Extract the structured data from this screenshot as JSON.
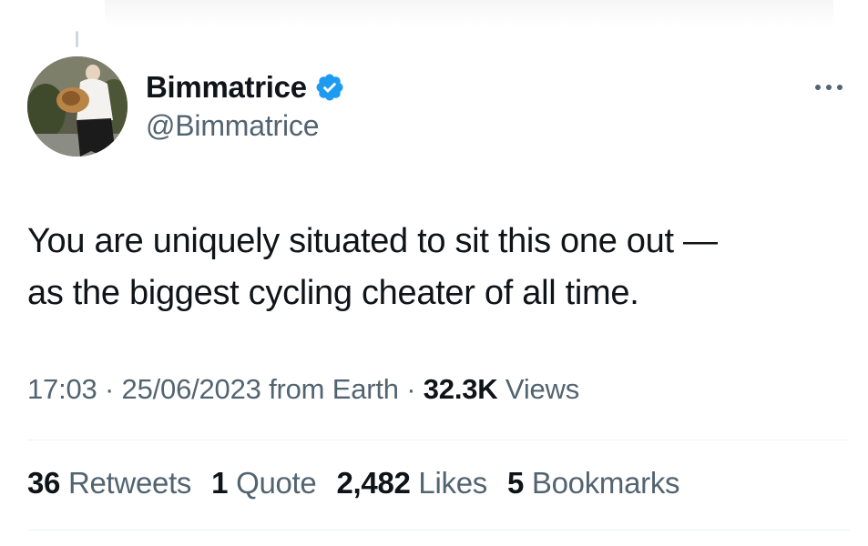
{
  "tweet": {
    "author": {
      "display_name": "Bimmatrice",
      "handle": "@Bimmatrice",
      "verified_icon": "verified-badge-icon",
      "verified_color": "#1d9bf0"
    },
    "text": "You are uniquely situated to sit this one out —\nas the biggest cycling cheater of all time.",
    "meta": {
      "time": "17:03",
      "sep1": " · ",
      "date": "25/06/2023",
      "source": " from Earth",
      "sep2": " · ",
      "views_count": "32.3K",
      "views_label": " Views"
    },
    "stats": {
      "retweets_count": "36",
      "retweets_label": " Retweets",
      "quotes_count": "1",
      "quotes_label": " Quote",
      "likes_count": "2,482",
      "likes_label": " Likes",
      "bookmarks_count": "5",
      "bookmarks_label": " Bookmarks"
    },
    "more_icon": "more-options-icon"
  },
  "colors": {
    "text_primary": "#0f1419",
    "text_secondary": "#536471",
    "divider": "#eff3f4"
  }
}
